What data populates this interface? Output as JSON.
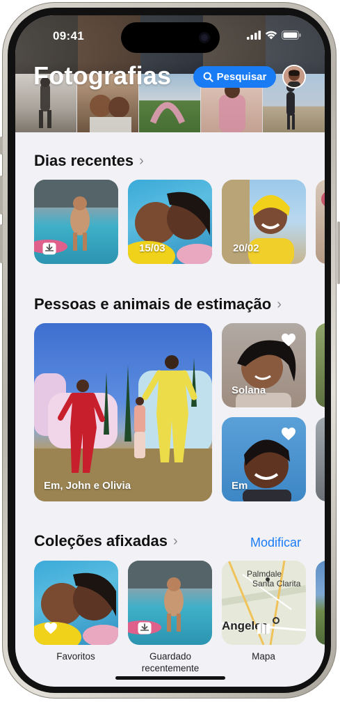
{
  "status_bar": {
    "time": "09:41"
  },
  "header": {
    "title": "Fotografias",
    "search_label": "Pesquisar"
  },
  "sections": {
    "recent_days": {
      "title": "Dias recentes",
      "cards": [
        {
          "label": ""
        },
        {
          "label": "15/03"
        },
        {
          "label": "20/02"
        }
      ]
    },
    "people_pets": {
      "title": "Pessoas e animais de estimação",
      "cards": [
        {
          "label": "Em, John e Olivia"
        },
        {
          "label": "Solana"
        },
        {
          "label": "Em"
        }
      ]
    },
    "pinned_collections": {
      "title": "Coleções afixadas",
      "modify_label": "Modificar",
      "items": [
        {
          "label": "Favoritos"
        },
        {
          "label": "Guardado recentemente"
        },
        {
          "label": "Mapa"
        }
      ],
      "map_labels": {
        "palmdale": "Palmdale",
        "santa_clarita": "Santa Clarita",
        "angeles": "Angeles"
      }
    }
  },
  "icons": {
    "search": "search-icon",
    "heart": "heart-icon",
    "chevron": "chevron-right-icon",
    "tray": "tray-download-icon",
    "map": "map-icon"
  },
  "colors": {
    "accent": "#1a7cf5",
    "background": "#f2f2f6"
  }
}
